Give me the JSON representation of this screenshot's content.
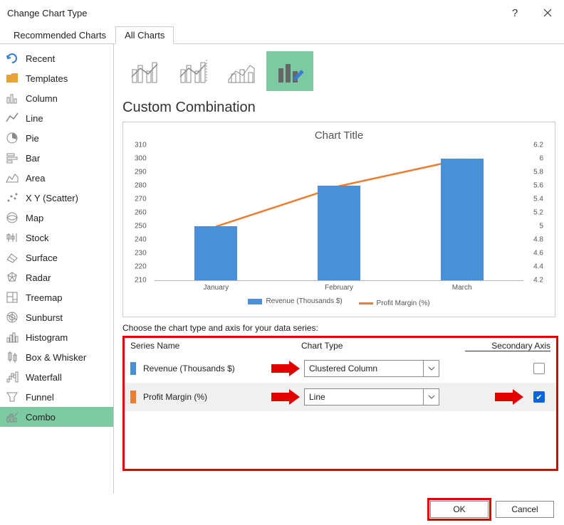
{
  "title": "Change Chart Type",
  "tabs": {
    "recommended": "Recommended Charts",
    "all": "All Charts"
  },
  "sidebar": {
    "items": [
      {
        "label": "Recent"
      },
      {
        "label": "Templates"
      },
      {
        "label": "Column"
      },
      {
        "label": "Line"
      },
      {
        "label": "Pie"
      },
      {
        "label": "Bar"
      },
      {
        "label": "Area"
      },
      {
        "label": "X Y (Scatter)"
      },
      {
        "label": "Map"
      },
      {
        "label": "Stock"
      },
      {
        "label": "Surface"
      },
      {
        "label": "Radar"
      },
      {
        "label": "Treemap"
      },
      {
        "label": "Sunburst"
      },
      {
        "label": "Histogram"
      },
      {
        "label": "Box & Whisker"
      },
      {
        "label": "Waterfall"
      },
      {
        "label": "Funnel"
      },
      {
        "label": "Combo"
      }
    ],
    "selected": 18
  },
  "section_title": "Custom Combination",
  "chart": {
    "title": "Chart Title",
    "legend": {
      "s1": "Revenue (Thousands $)",
      "s2": "Profit Margin (%)"
    }
  },
  "series_prompt": "Choose the chart type and axis for your data series:",
  "series_table": {
    "headers": {
      "name": "Series Name",
      "type": "Chart Type",
      "axis": "Secondary Axis"
    },
    "rows": [
      {
        "name": "Revenue (Thousands $)",
        "type": "Clustered Column",
        "secondary": false,
        "color": "#4a90d9"
      },
      {
        "name": "Profit Margin (%)",
        "type": "Line",
        "secondary": true,
        "color": "#ed7d31"
      }
    ]
  },
  "buttons": {
    "ok": "OK",
    "cancel": "Cancel"
  },
  "chart_data": {
    "type": "combo",
    "categories": [
      "January",
      "February",
      "March"
    ],
    "series": [
      {
        "name": "Revenue (Thousands $)",
        "type": "bar",
        "axis": "primary",
        "values": [
          250,
          280,
          300
        ]
      },
      {
        "name": "Profit Margin (%)",
        "type": "line",
        "axis": "secondary",
        "values": [
          5.0,
          5.6,
          6.0
        ]
      }
    ],
    "y_primary": {
      "min": 210,
      "max": 310,
      "step": 10
    },
    "y_secondary": {
      "min": 4.2,
      "max": 6.2,
      "step": 0.2
    },
    "title": "Chart Title"
  }
}
